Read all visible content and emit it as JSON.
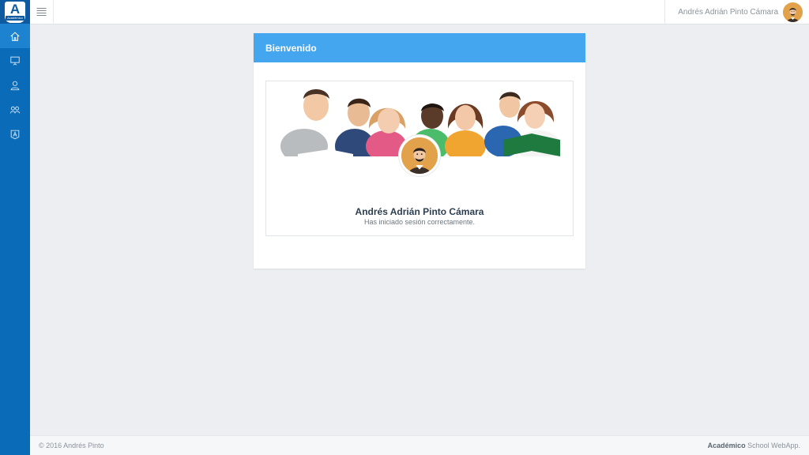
{
  "app": {
    "logo_letter": "A",
    "logo_ribbon": "Académico"
  },
  "sidebar": {
    "items": [
      {
        "icon": "home-icon",
        "active": true
      },
      {
        "icon": "presentation-icon",
        "active": false
      },
      {
        "icon": "user-icon",
        "active": false
      },
      {
        "icon": "group-icon",
        "active": false
      },
      {
        "icon": "academic-logo-icon",
        "active": false
      }
    ]
  },
  "topbar": {
    "menu_icon": "hamburger-icon",
    "user_name": "Andrés Adrián Pinto Cámara"
  },
  "welcome_card": {
    "title": "Bienvenido",
    "profile_name": "Andrés Adrián Pinto Cámara",
    "status": "Has iniciado sesión correctamente."
  },
  "footer": {
    "copyright": "© 2016 Andrés Pinto",
    "brand_bold": "Académico",
    "brand_rest": " School WebApp."
  },
  "colors": {
    "sidebar": "#0a6bb8",
    "sidebar_active": "#1d82d0",
    "card_header": "#45a6f0",
    "avatar_bg": "#e2a24c"
  }
}
